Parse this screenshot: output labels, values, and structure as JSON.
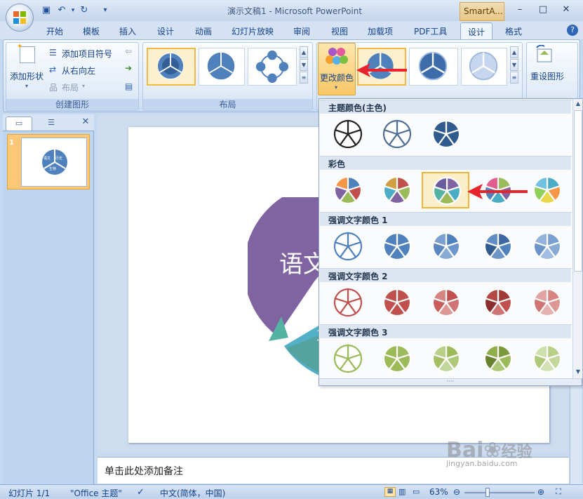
{
  "window": {
    "title": "演示文稿1 - Microsoft PowerPoint",
    "context_tab": "SmartA...",
    "minimize": "–",
    "maximize": "□",
    "close": "✕"
  },
  "tabs": [
    "开始",
    "模板",
    "插入",
    "设计",
    "动画",
    "幻灯片放映",
    "审阅",
    "视图",
    "加载项",
    "PDF工具",
    "设计",
    "格式"
  ],
  "active_tab_index": 10,
  "ribbon": {
    "create_graphic": {
      "label": "创建图形",
      "add_shape": "添加形状",
      "add_bullet": "添加项目符号",
      "right_to_left": "从右向左",
      "layout": "布局"
    },
    "layouts": {
      "label": "布局"
    },
    "change_colors": "更改颜色",
    "reset_graphic": "重设图形"
  },
  "left_pane": {
    "slide_number": "1"
  },
  "slide": {
    "text_purple": "语文",
    "text_teal": "生"
  },
  "thumb": {
    "t1": "语文",
    "t2": "历史",
    "t3": "生物"
  },
  "notes": {
    "placeholder": "单击此处添加备注"
  },
  "dropdown": {
    "sections": [
      {
        "title": "主题颜色(主色)",
        "palettes": [
          [
            "#ffffff",
            "#ffffff",
            "#ffffff",
            "#ffffff",
            "#ffffff"
          ],
          [
            "#ffffff",
            "#ffffff",
            "#ffffff",
            "#ffffff",
            "#ffffff"
          ],
          [
            "#2f5b8f",
            "#2f5b8f",
            "#2f5b8f",
            "#2f5b8f",
            "#2f5b8f"
          ]
        ],
        "strokes": [
          "#222222",
          "#4f6f96",
          "#ffffff"
        ]
      },
      {
        "title": "彩色",
        "palettes": [
          [
            "#4f81bd",
            "#c0504d",
            "#9bbb59",
            "#8064a2",
            "#f79646"
          ],
          [
            "#c0504d",
            "#9bbb59",
            "#8064a2",
            "#4bacc6",
            "#d0a040"
          ],
          [
            "#8064a2",
            "#4bacc6",
            "#9bbb59",
            "#53b3a0",
            "#6a5a9e"
          ],
          [
            "#9bbb59",
            "#8064a2",
            "#4bacc6",
            "#4f81bd",
            "#e05d8e"
          ],
          [
            "#4bacc6",
            "#f79646",
            "#e8d84a",
            "#8fd05a",
            "#70c0e0"
          ]
        ]
      },
      {
        "title": "强调文字颜色 1",
        "palettes": [
          [
            "#ffffff",
            "#ffffff",
            "#ffffff",
            "#ffffff",
            "#ffffff"
          ],
          [
            "#4f81bd",
            "#4f81bd",
            "#4f81bd",
            "#4f81bd",
            "#4f81bd"
          ],
          [
            "#4f81bd",
            "#6c95c9",
            "#89aad4",
            "#5b87c1",
            "#7aa0d0"
          ],
          [
            "#3d6aa4",
            "#4f81bd",
            "#6c95c9",
            "#2f5b8f",
            "#5f8cc4"
          ],
          [
            "#7aa0d0",
            "#89aad4",
            "#a2bde0",
            "#6c95c9",
            "#93b3dc"
          ]
        ],
        "strokes": [
          "#4f81bd",
          "#ffffff",
          "#ffffff",
          "#ffffff",
          "#ffffff"
        ]
      },
      {
        "title": "强调文字颜色 2",
        "palettes": [
          [
            "#ffffff",
            "#ffffff",
            "#ffffff",
            "#ffffff",
            "#ffffff"
          ],
          [
            "#c0504d",
            "#c0504d",
            "#c0504d",
            "#c0504d",
            "#c0504d"
          ],
          [
            "#c0504d",
            "#cf7472",
            "#dc9795",
            "#c85f5c",
            "#d68583"
          ],
          [
            "#9e3b38",
            "#c0504d",
            "#cf7472",
            "#8a2f2d",
            "#b24744"
          ],
          [
            "#d68583",
            "#dc9795",
            "#e5b0ae",
            "#cf7472",
            "#e2a4a2"
          ]
        ],
        "strokes": [
          "#c0504d",
          "#ffffff",
          "#ffffff",
          "#ffffff",
          "#ffffff"
        ]
      },
      {
        "title": "强调文字颜色 3",
        "palettes": [
          [
            "#ffffff",
            "#ffffff",
            "#ffffff",
            "#ffffff",
            "#ffffff"
          ],
          [
            "#9bbb59",
            "#9bbb59",
            "#9bbb59",
            "#9bbb59",
            "#9bbb59"
          ],
          [
            "#9bbb59",
            "#afc97a",
            "#c3d69b",
            "#a3c065",
            "#b8cf87"
          ],
          [
            "#7a9a3d",
            "#9bbb59",
            "#afc97a",
            "#66822f",
            "#8eb04b"
          ],
          [
            "#b8cf87",
            "#c3d69b",
            "#d3e2b4",
            "#afc97a",
            "#cde0ab"
          ]
        ],
        "strokes": [
          "#9bbb59",
          "#ffffff",
          "#ffffff",
          "#ffffff",
          "#ffffff"
        ]
      }
    ],
    "selected": {
      "section": 1,
      "index": 2
    }
  },
  "status": {
    "slide": "幻灯片 1/1",
    "theme": "\"Office 主题\"",
    "language": "中文(简体，中国)",
    "zoom": "63%"
  },
  "watermark": {
    "text": "Baidu经验",
    "url": "jingyan.baidu.com"
  }
}
